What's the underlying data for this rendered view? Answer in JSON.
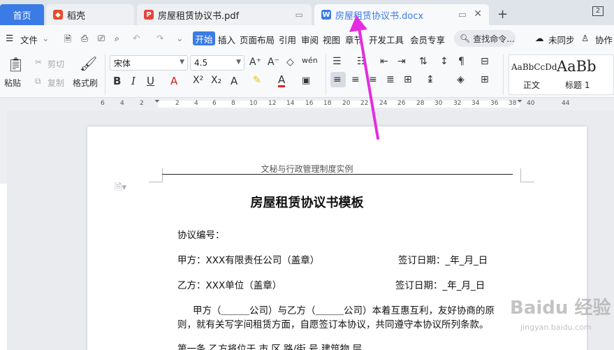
{
  "tabs": {
    "home": "首页",
    "daoke": "稻壳",
    "pdf": "房屋租赁协议书.pdf",
    "docx": "房屋租赁协议书.docx",
    "page_indicator": "2"
  },
  "menu": {
    "file": "文件",
    "start": "开始",
    "insert": "插入",
    "layout": "页面布局",
    "reference": "引用",
    "review": "审阅",
    "view": "视图",
    "chapter": "章节",
    "dev": "开发工具",
    "member": "会员专享",
    "search": "查找命令...",
    "sync": "未同步",
    "collab": "协作"
  },
  "ribbon": {
    "paste": "粘贴",
    "cut": "剪切",
    "copy": "复制",
    "format_painter": "格式刷",
    "font_name": "宋体",
    "font_size": "4.5",
    "style_normal_preview": "AaBbCcDd",
    "style_normal": "正文",
    "style_h1_preview": "AaBb",
    "style_h1": "标题 1"
  },
  "ruler": {
    "numbers": [
      "6",
      "4",
      "2",
      "2",
      "4",
      "6",
      "8",
      "10",
      "12",
      "14",
      "16",
      "18",
      "20",
      "22",
      "24",
      "26",
      "28",
      "30",
      "32",
      "34",
      "36",
      "38",
      "40",
      "44"
    ],
    "end": "44"
  },
  "document": {
    "header": "文秘与行政管理制度实例",
    "title": "房屋租赁协议书模板",
    "line1": "协议编号：",
    "party_a": "甲方：XXX有限责任公司（盖章）",
    "date_a": "签订日期：_年_月_日",
    "party_b": "乙方：XXX单位（盖章）",
    "date_b": "签订日期：_年_月_日",
    "para1_l1": "甲方（＿＿＿公司）与乙方（＿＿＿公司）本着互惠互利，友好协商的原",
    "para1_l2": "则，就有关写字间租赁方面，自愿签订本协议，共同遵守本协议所列条款。",
    "clause1": "第一条  乙方将位于      市      区      路/街      号      建筑物      层"
  },
  "watermark": {
    "brand": "Baidu 经验",
    "url": "jingyan.baidu.com"
  },
  "colors": {
    "accent": "#3b7be6",
    "annotation": "#e22ee0"
  }
}
